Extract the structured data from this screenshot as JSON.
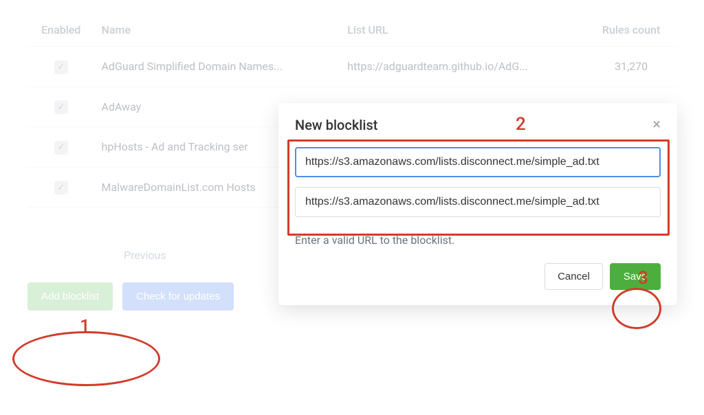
{
  "table": {
    "headers": {
      "enabled": "Enabled",
      "name": "Name",
      "url": "List URL",
      "rules": "Rules count"
    },
    "rows": [
      {
        "name": "AdGuard Simplified Domain Names...",
        "url": "https://adguardteam.github.io/AdG...",
        "rules": "31,270"
      },
      {
        "name": "AdAway",
        "url": "",
        "rules": ""
      },
      {
        "name": "hpHosts - Ad and Tracking ser",
        "url": "",
        "rules": ""
      },
      {
        "name": "MalwareDomainList.com Hosts",
        "url": "",
        "rules": ""
      }
    ]
  },
  "pagination": {
    "previous": "Previous"
  },
  "buttons": {
    "add": "Add blocklist",
    "check": "Check for updates"
  },
  "modal": {
    "title": "New blocklist",
    "input1": "https://s3.amazonaws.com/lists.disconnect.me/simple_ad.txt",
    "input2": "https://s3.amazonaws.com/lists.disconnect.me/simple_ad.txt",
    "helper": "Enter a valid URL to the blocklist.",
    "cancel": "Cancel",
    "save": "Save"
  },
  "annotations": {
    "n1": "1",
    "n2": "2",
    "n3": "3"
  }
}
